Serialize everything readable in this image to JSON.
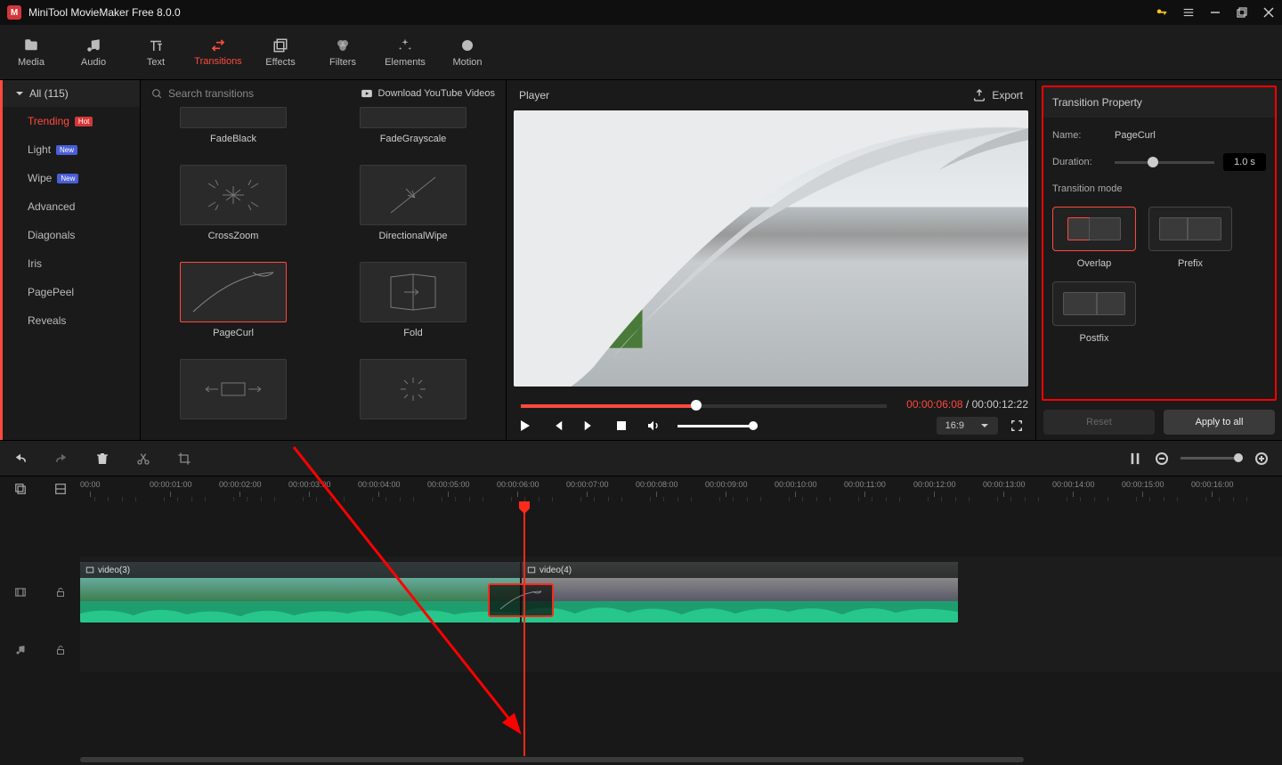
{
  "app": {
    "title": "MiniTool MovieMaker Free 8.0.0"
  },
  "toolbar": {
    "tabs": [
      {
        "label": "Media",
        "icon": "folder"
      },
      {
        "label": "Audio",
        "icon": "music"
      },
      {
        "label": "Text",
        "icon": "text"
      },
      {
        "label": "Transitions",
        "icon": "swap",
        "active": true
      },
      {
        "label": "Effects",
        "icon": "stack"
      },
      {
        "label": "Filters",
        "icon": "filters"
      },
      {
        "label": "Elements",
        "icon": "sparkle"
      },
      {
        "label": "Motion",
        "icon": "circle"
      }
    ]
  },
  "categories": {
    "header": "All (115)",
    "items": [
      {
        "label": "Trending",
        "badge": "Hot",
        "badgeClass": "badge-hot",
        "active": true
      },
      {
        "label": "Light",
        "badge": "New",
        "badgeClass": "badge-new"
      },
      {
        "label": "Wipe",
        "badge": "New",
        "badgeClass": "badge-new"
      },
      {
        "label": "Advanced"
      },
      {
        "label": "Diagonals"
      },
      {
        "label": "Iris"
      },
      {
        "label": "PagePeel"
      },
      {
        "label": "Reveals"
      }
    ]
  },
  "search": {
    "placeholder": "Search transitions"
  },
  "ytlink": "Download YouTube Videos",
  "transitions": [
    {
      "label": "FadeBlack",
      "halfTop": true
    },
    {
      "label": "FadeGrayscale",
      "halfTop": true
    },
    {
      "label": "CrossZoom"
    },
    {
      "label": "DirectionalWipe"
    },
    {
      "label": "PageCurl",
      "selected": true
    },
    {
      "label": "Fold"
    },
    {
      "label": "",
      "noLabel": true
    },
    {
      "label": "",
      "noLabel": true
    }
  ],
  "player": {
    "title": "Player",
    "export": "Export",
    "currentTime": "00:00:06:08",
    "totalTime": "00:00:12:22",
    "aspect": "16:9"
  },
  "props": {
    "title": "Transition Property",
    "nameLabel": "Name:",
    "nameValue": "PageCurl",
    "durationLabel": "Duration:",
    "durationValue": "1.0 s",
    "modeLabel": "Transition mode",
    "modes": [
      {
        "name": "Overlap",
        "selected": true,
        "cls": "mode-overlap"
      },
      {
        "name": "Prefix",
        "cls": "mode-prefix"
      },
      {
        "name": "Postfix",
        "cls": "mode-postfix"
      }
    ],
    "reset": "Reset",
    "apply": "Apply to all"
  },
  "ruler": {
    "ticks": [
      "00:00",
      "00:00:01:00",
      "00:00:02:00",
      "00:00:03:00",
      "00:00:04:00",
      "00:00:05:00",
      "00:00:06:00",
      "00:00:07:00",
      "00:00:08:00",
      "00:00:09:00",
      "00:00:10:00",
      "00:00:11:00",
      "00:00:12:00",
      "00:00:13:00",
      "00:00:14:00",
      "00:00:15:00",
      "00:00:16:00"
    ]
  },
  "clips": {
    "clip1": "video(3)",
    "clip2": "video(4)"
  }
}
